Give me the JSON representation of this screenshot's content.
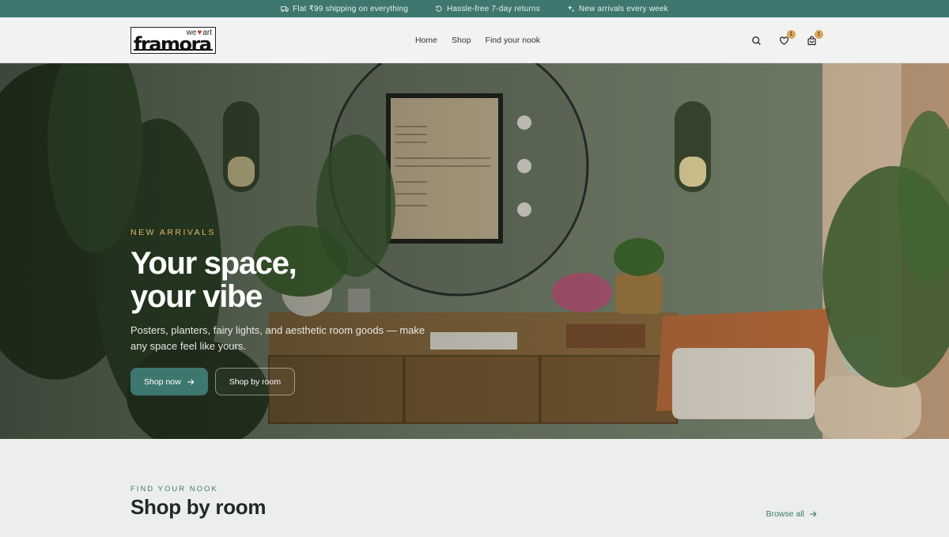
{
  "announcement": {
    "items": [
      {
        "icon": "truck-icon",
        "text": "Flat ₹99 shipping on everything"
      },
      {
        "icon": "return-icon",
        "text": "Hassle-free 7-day returns"
      },
      {
        "icon": "sparkle-icon",
        "text": "New arrivals every week"
      }
    ]
  },
  "header": {
    "logo": {
      "tagline_pre": "we",
      "tagline_post": "art",
      "wordmark": "framora"
    },
    "nav": [
      "Home",
      "Shop",
      "Find your nook"
    ],
    "icons": {
      "search": "search-icon",
      "wishlist": {
        "icon": "heart-icon",
        "count": "1"
      },
      "cart": {
        "icon": "bag-icon",
        "count": "1"
      }
    }
  },
  "hero": {
    "eyebrow": "NEW ARRIVALS",
    "title_line1": "Your space,",
    "title_line2": "your vibe",
    "subtitle": "Posters, planters, fairy lights, and aesthetic room goods — make any space feel like yours.",
    "primary_button": "Shop now",
    "secondary_button": "Shop by room"
  },
  "rooms": {
    "eyebrow": "FIND YOUR NOOK",
    "title": "Shop by room",
    "browse_link": "Browse all"
  },
  "colors": {
    "accent": "#3e7770",
    "eyebrow_gold": "#e2b66f",
    "badge": "#d9a65c"
  }
}
